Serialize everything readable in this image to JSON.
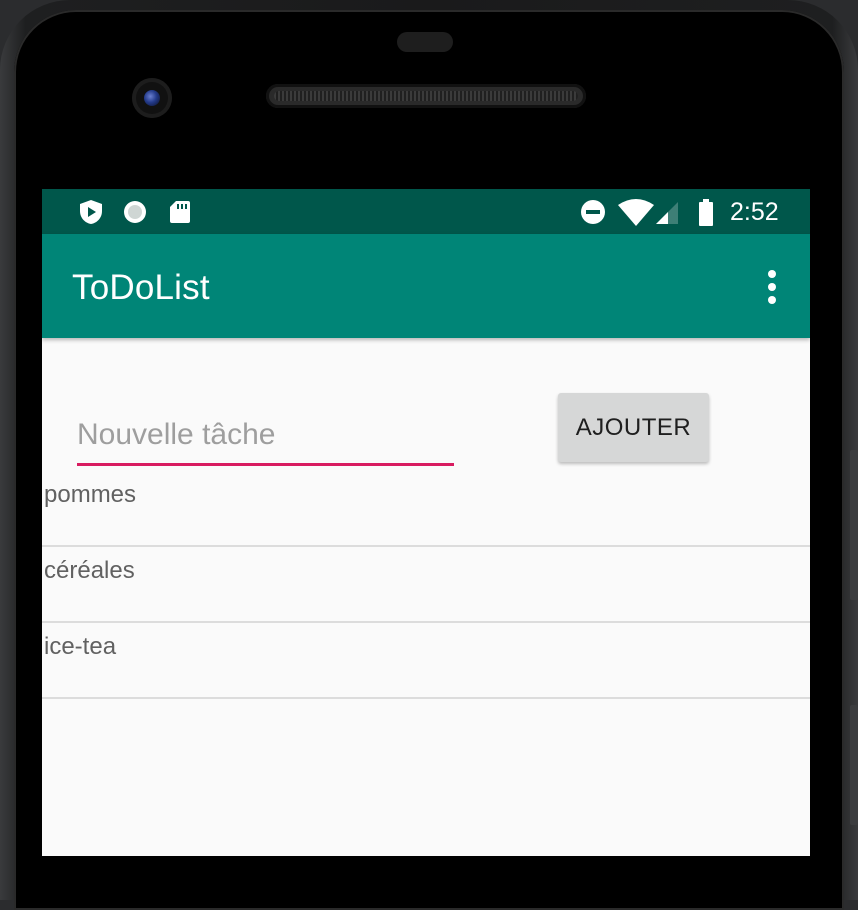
{
  "status_bar": {
    "time": "2:52",
    "left_icons": [
      "play-protect-icon",
      "circle-notification-icon",
      "sd-card-icon"
    ],
    "right_icons": [
      "do-not-disturb-icon",
      "wifi-icon",
      "cell-signal-icon",
      "battery-icon"
    ]
  },
  "app_bar": {
    "title": "ToDoList",
    "menu_icon": "more-vert-icon"
  },
  "task_form": {
    "input_placeholder": "Nouvelle tâche",
    "input_value": "",
    "add_label": "AJOUTER"
  },
  "tasks": [
    {
      "label": "pommes"
    },
    {
      "label": "céréales"
    },
    {
      "label": "ice-tea"
    }
  ],
  "colors": {
    "status_bar": "#00574b",
    "app_bar": "#008577",
    "accent": "#d81b60",
    "button": "#d6d7d7"
  }
}
